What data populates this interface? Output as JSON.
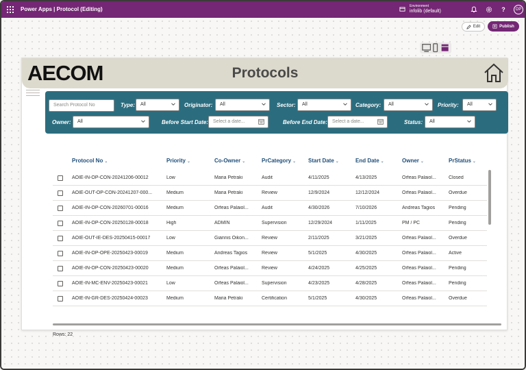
{
  "topbar": {
    "title": "Power Apps  |  Protocol (Editing)",
    "environment_label": "Environment",
    "environment_value": "infolib (default)",
    "avatar_initials": "OP"
  },
  "toolbar": {
    "edit_label": "Edit",
    "publish_label": "Publish"
  },
  "header": {
    "logo_text": "AECOM",
    "page_title": "Protocols"
  },
  "filters": {
    "search_placeholder": "Search Protocol No",
    "type_label": "Type:",
    "type_value": "All",
    "originator_label": "Originator:",
    "originator_value": "All",
    "sector_label": "Sector:",
    "sector_value": "All",
    "category_label": "Category:",
    "category_value": "All",
    "priority_label": "Priority:",
    "priority_value": "All",
    "owner_label": "Owner:",
    "owner_value": "All",
    "before_start_label": "Before Start Date:",
    "before_start_placeholder": "Select a date...",
    "before_end_label": "Before End Date:",
    "before_end_placeholder": "Select a date...",
    "status_label": "Status:",
    "status_value": "All"
  },
  "table": {
    "columns": [
      "Protocol No",
      "Priority",
      "Co-Owner",
      "PrCategory",
      "Start Date",
      "End Date",
      "Owner",
      "PrStatus"
    ],
    "rows": [
      [
        "AOIE-IN-OP-CON-20241206-00012",
        "Low",
        "Maria Petraki",
        "Audit",
        "4/11/2025",
        "4/13/2025",
        "Orfeas Palaiol...",
        "Closed"
      ],
      [
        "AOIE-OUT-OP-CON-20241207-000...",
        "Medium",
        "Maria Petraki",
        "Review",
        "12/9/2024",
        "12/12/2024",
        "Orfeas Palaiol...",
        "Overdue"
      ],
      [
        "AOIE-IN-OP-CON-20260701-00016",
        "Medium",
        "Orfeas Palaiol...",
        "Audit",
        "4/30/2026",
        "7/10/2026",
        "Andreas Tagios",
        "Pending"
      ],
      [
        "AOIE-IN-OP-CON-20250128-00018",
        "High",
        "ADMIN",
        "Supervision",
        "12/29/2024",
        "1/11/2025",
        "PM / PC",
        "Pending"
      ],
      [
        "AOIE-OUT-IE-DES-20250415-00017",
        "Low",
        "Giannis Oikon...",
        "Review",
        "2/11/2025",
        "3/21/2025",
        "Orfeas Palaiol...",
        "Overdue"
      ],
      [
        "AOIE-IN-OP-OPE-20250423-00019",
        "Medium",
        "Andreas Tagios",
        "Review",
        "5/1/2025",
        "4/30/2025",
        "Orfeas Palaiol...",
        "Active"
      ],
      [
        "AOIE-IN-OP-CON-20250423-00020",
        "Medium",
        "Orfeas Palaiol...",
        "Review",
        "4/24/2025",
        "4/25/2025",
        "Orfeas Palaiol...",
        "Pending"
      ],
      [
        "AOIE-IN-MC-ENV-20250423-00021",
        "Low",
        "Orfeas Palaiol...",
        "Supervision",
        "4/23/2025",
        "4/28/2025",
        "Orfeas Palaiol...",
        "Pending"
      ],
      [
        "AOIE-IN-GR-DES-20250424-00023",
        "Medium",
        "Maria Petraki",
        "Certification",
        "5/1/2025",
        "4/30/2025",
        "Orfeas Palaiol...",
        "Overdue"
      ]
    ],
    "rows_count": "Rows: 22"
  },
  "colors": {
    "brand": "#742774",
    "filter_panel": "#2b6d7f",
    "header_bg": "#dcd9cd",
    "column_header": "#1f4e79"
  }
}
